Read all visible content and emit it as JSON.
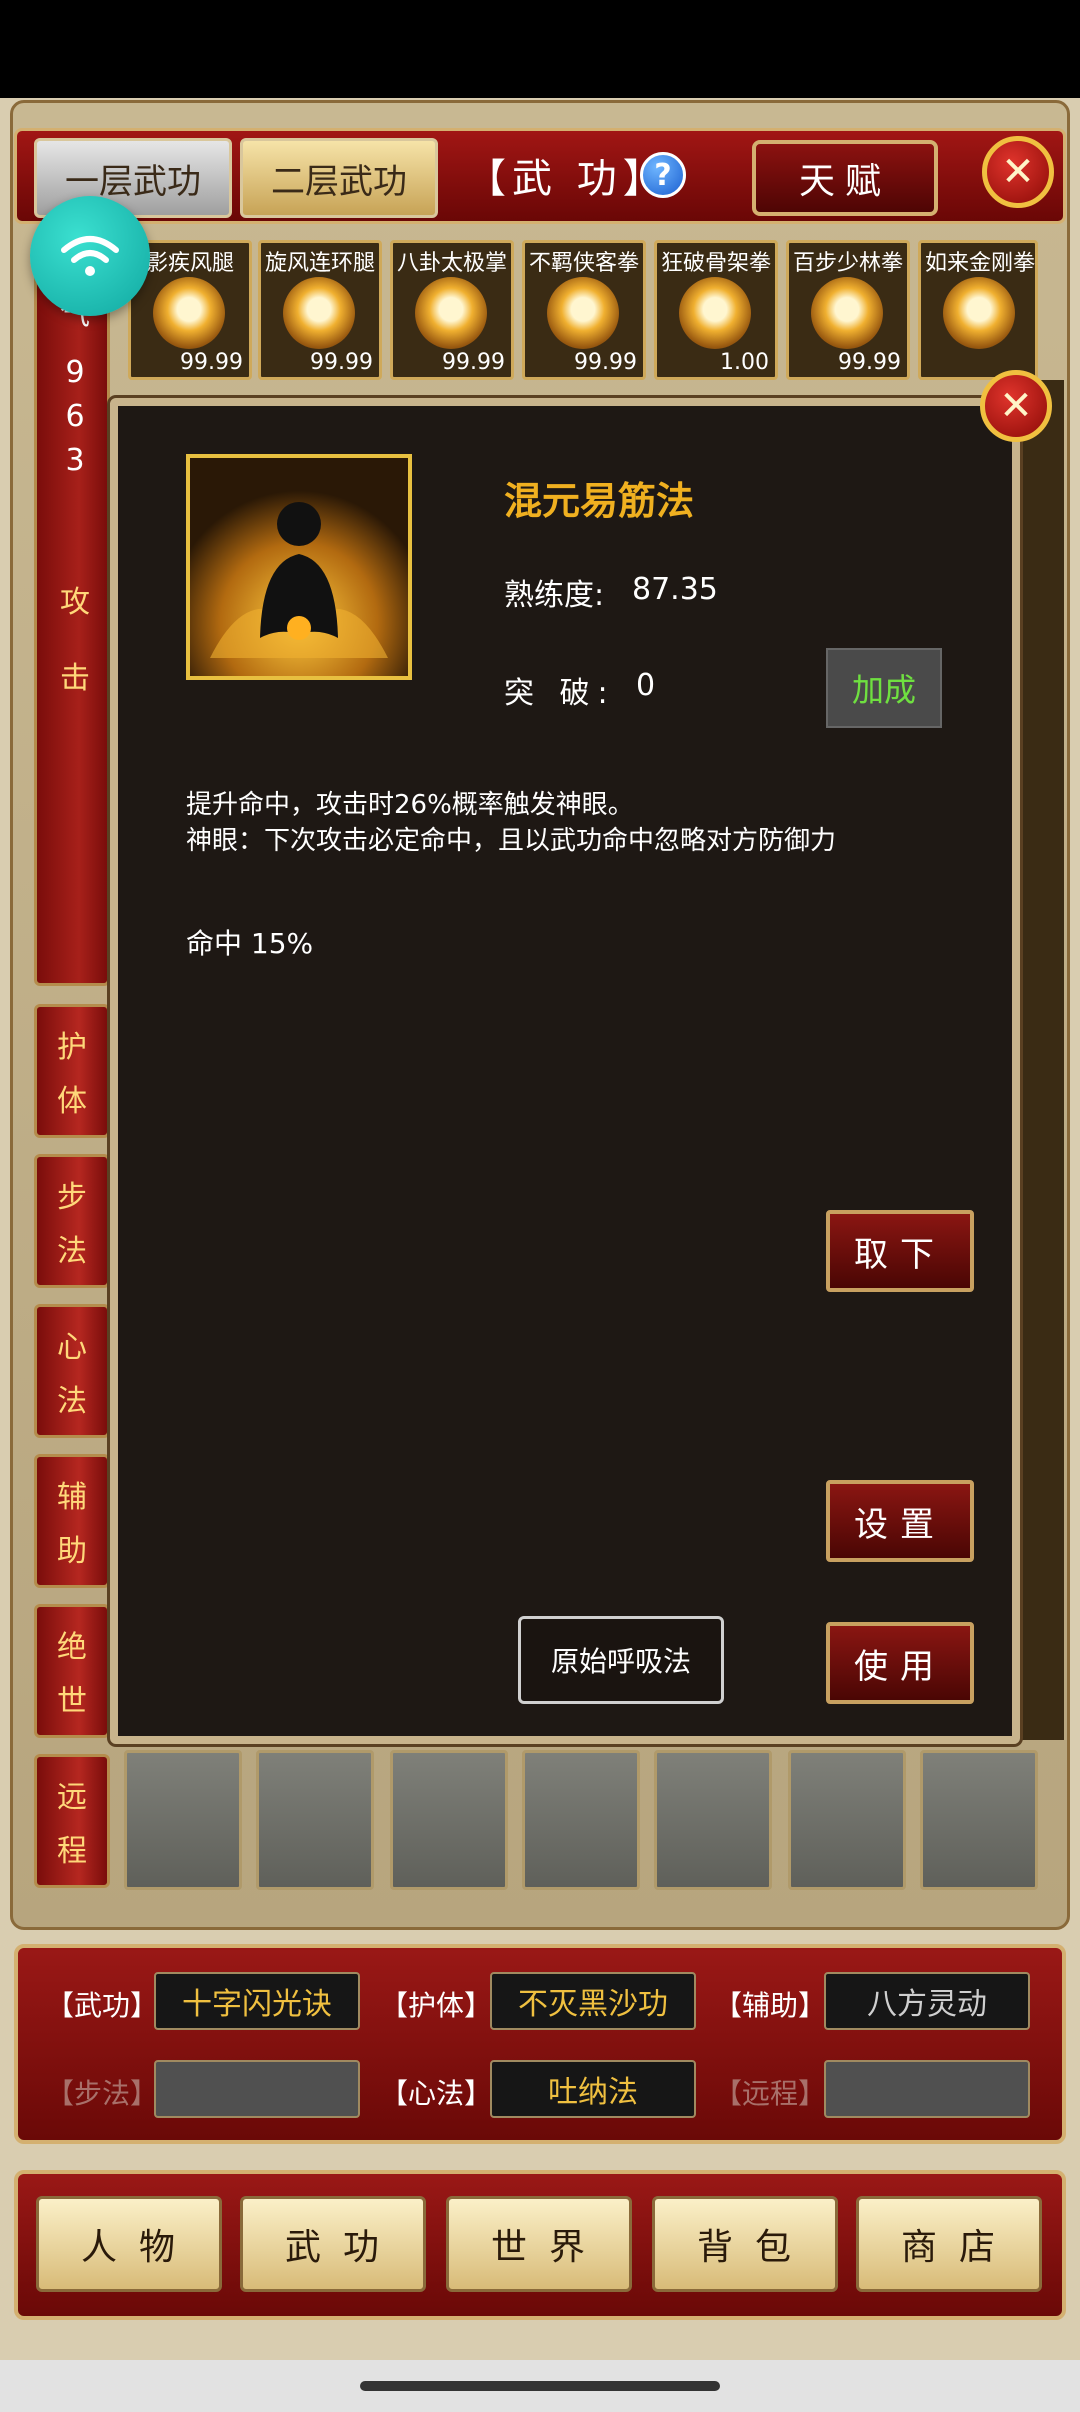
{
  "header": {
    "tabs": [
      {
        "label": "一层武功",
        "active": false
      },
      {
        "label": "二层武功",
        "active": true
      }
    ],
    "title": "【武 功】",
    "help_icon": "question-mark",
    "talent_label": "天赋",
    "close_icon": "close-x"
  },
  "left_stat": {
    "partial_label": "气",
    "digits": [
      "9",
      "6",
      "3"
    ],
    "category_top": [
      "攻",
      "击"
    ]
  },
  "categories": [
    {
      "chars": [
        "护",
        "体"
      ]
    },
    {
      "chars": [
        "步",
        "法"
      ]
    },
    {
      "chars": [
        "心",
        "法"
      ]
    },
    {
      "chars": [
        "辅",
        "助"
      ]
    },
    {
      "chars": [
        "绝",
        "世"
      ]
    },
    {
      "chars": [
        "远",
        "程"
      ]
    }
  ],
  "skills": [
    {
      "name": "影疾风腿",
      "value": "99.99"
    },
    {
      "name": "旋风连环腿",
      "value": "99.99"
    },
    {
      "name": "八卦太极掌",
      "value": "99.99"
    },
    {
      "name": "不羁侠客拳",
      "value": "99.99"
    },
    {
      "name": "狂破骨架拳",
      "value": "1.00"
    },
    {
      "name": "百步少林拳",
      "value": "99.99"
    },
    {
      "name": "如来金刚拳",
      "value": ""
    }
  ],
  "detail": {
    "name": "混元易筋法",
    "proficiency_label": "熟练度:",
    "proficiency_value": "87.35",
    "breakthrough_label": "突 破:",
    "breakthrough_value": "0",
    "bonus_label": "加成",
    "desc_line1": "提升命中，攻击时26%概率触发神眼。",
    "desc_line2": "神眼：下次攻击必定命中，且以武功命中忽略对方防御力",
    "hit_line": "命中  15%",
    "remove_label": "取下",
    "settings_label": "设置",
    "use_label": "使用",
    "breath_label": "原始呼吸法"
  },
  "equipped": {
    "wugong_label": "【武功】",
    "wugong_value": "十字闪光诀",
    "huti_label": "【护体】",
    "huti_value": "不灭黑沙功",
    "fuzhu_label": "【辅助】",
    "fuzhu_value": "八方灵动",
    "bufa_label": "【步法】",
    "bufa_value": "",
    "xinfa_label": "【心法】",
    "xinfa_value": "吐纳法",
    "yuancheng_label": "【远程】",
    "yuancheng_value": ""
  },
  "nav": [
    "人物",
    "武功",
    "世界",
    "背包",
    "商店"
  ],
  "colors": {
    "frame_red": "#8a0f0c",
    "gold_border": "#d4b070",
    "title_gold": "#f0b020",
    "bonus_green": "#6fe040"
  }
}
